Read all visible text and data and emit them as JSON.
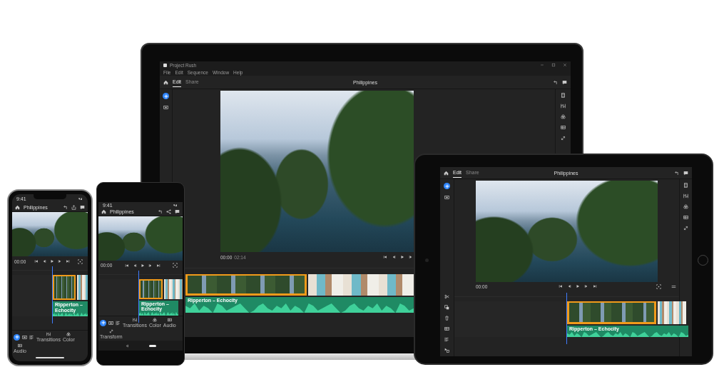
{
  "laptop": {
    "window": {
      "title": "Project Rush"
    },
    "menu": [
      "File",
      "Edit",
      "Sequence",
      "Window",
      "Help"
    ],
    "tabs": [
      {
        "label": "Edit",
        "selected": true
      },
      {
        "label": "Share",
        "selected": false
      }
    ],
    "project_title": "Philippines",
    "timecode": "00:00",
    "duration": "02:14",
    "clips": [
      {
        "kind": "islands",
        "selected": true
      },
      {
        "kind": "people",
        "selected": false
      }
    ],
    "audio_clip": "Ripperton – Echocity"
  },
  "tablet": {
    "tabs": [
      {
        "label": "Edit",
        "selected": true
      },
      {
        "label": "Share",
        "selected": false
      }
    ],
    "project_title": "Philippines",
    "timecode": "00:00",
    "clips": [
      {
        "kind": "islands",
        "selected": true
      },
      {
        "kind": "people",
        "selected": false
      }
    ],
    "audio_clip": "Ripperton – Echocity"
  },
  "iphone": {
    "status_time": "9:41",
    "project_title": "Philippines",
    "timecode": "00:00",
    "clips": [
      {
        "kind": "islands",
        "selected": true
      },
      {
        "kind": "people",
        "selected": false
      }
    ],
    "audio_clip": "Ripperton – Echocity",
    "toolbar": [
      "Transitions",
      "Color",
      "Audio"
    ]
  },
  "android": {
    "status_time": "9:41",
    "project_title": "Philippines",
    "timecode": "00:00",
    "clips": [
      {
        "kind": "islands",
        "selected": true
      },
      {
        "kind": "people",
        "selected": false
      }
    ],
    "audio_clip": "Ripperton – Echocity",
    "toolbar": [
      "Transitions",
      "Color",
      "Audio",
      "Transform"
    ]
  }
}
